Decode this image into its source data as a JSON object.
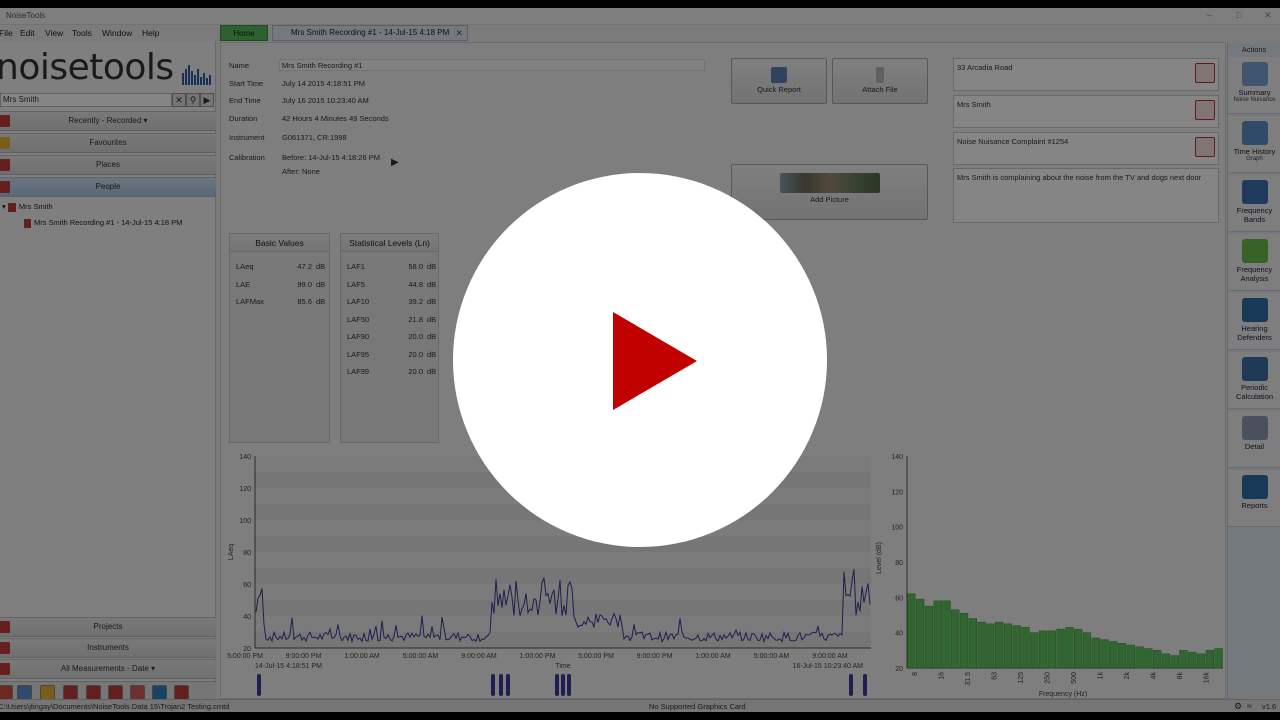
{
  "window": {
    "title": "NoiseTools"
  },
  "menu": [
    "File",
    "Edit",
    "View",
    "Tools",
    "Window",
    "Help"
  ],
  "logo": {
    "text": "noisetools"
  },
  "search": {
    "value": "Mrs Smith"
  },
  "nav": {
    "recent": "Recently - Recorded",
    "favourites": "Favourites",
    "places": "Places",
    "people": "People",
    "projects": "Projects",
    "instruments": "Instruments",
    "all_measurements": "All Measurements - Date"
  },
  "tree": {
    "person": "Mrs Smith",
    "recording": "Mrs Smith Recording #1 - 14-Jul-15 4:18 PM"
  },
  "tabs": {
    "home": "Home",
    "recording": "Mrs Smith Recording #1 - 14-Jul-15 4:18 PM"
  },
  "info": {
    "name_label": "Name",
    "name": "Mrs Smith Recording #1",
    "start_label": "Start Time",
    "start": "July 14 2015 4:18:51 PM",
    "end_label": "End Time",
    "end": "July 16 2015 10:23:40 AM",
    "duration_label": "Duration",
    "duration": "42 Hours 4 Minutes 49 Seconds",
    "instrument_label": "Instrument",
    "instrument": "G061371, CR:1998",
    "calibration_label": "Calibration",
    "cal_before": "Before: 14-Jul-15 4:18:26 PM",
    "cal_after": "After: None"
  },
  "buttons": {
    "quick_report": "Quick Report",
    "attach_file": "Attach File",
    "add_picture": "Add Picture"
  },
  "right_info": {
    "address": "33 Arcadia Road",
    "person": "Mrs Smith",
    "complaint": "Noise Nuisance Complaint #1254",
    "notes": "Mrs Smith is complaining about the noise from the TV and dogs next door"
  },
  "basic_values": {
    "title": "Basic Values",
    "unit": "dB",
    "rows": [
      {
        "name": "LAeq",
        "value": "47.2"
      },
      {
        "name": "LAE",
        "value": "99.0"
      },
      {
        "name": "LAFMax",
        "value": "85.6"
      }
    ]
  },
  "stat_levels": {
    "title": "Statistical Levels (Ln)",
    "unit": "dB",
    "rows": [
      {
        "name": "LAF1",
        "value": "58.0"
      },
      {
        "name": "LAF5",
        "value": "44.8"
      },
      {
        "name": "LAF10",
        "value": "39.2"
      },
      {
        "name": "LAF50",
        "value": "21.8"
      },
      {
        "name": "LAF90",
        "value": "20.0"
      },
      {
        "name": "LAF95",
        "value": "20.0"
      },
      {
        "name": "LAF99",
        "value": "20.0"
      }
    ]
  },
  "time_chart": {
    "ylabel": "LAeq",
    "xlabel": "Time",
    "ylim": [
      20,
      140
    ],
    "yticks": [
      "140",
      "120",
      "100",
      "80",
      "60",
      "40",
      "20"
    ],
    "xticks": [
      "5:00:00 PM",
      "9:00:00 PM",
      "1:00:00 AM",
      "5:00:00 AM",
      "9:00:00 AM",
      "1:00:00 PM",
      "5:00:00 PM",
      "9:00:00 PM",
      "1:00:00 AM",
      "5:00:00 AM",
      "9:00:00 AM"
    ],
    "start_label": "14-Jul-15 4:18:51 PM",
    "end_label": "16-Jul-15 10:23:40 AM",
    "color": "#3a3a9a"
  },
  "freq_chart": {
    "ylabel": "Level (dB)",
    "xlabel": "Frequency (Hz)",
    "ylim": [
      20,
      140
    ],
    "yticks": [
      "140",
      "120",
      "100",
      "80",
      "60",
      "40",
      "20"
    ],
    "xticks": [
      "8",
      "16",
      "31.5",
      "63",
      "125",
      "250",
      "500",
      "1k",
      "2k",
      "4k",
      "8k",
      "16k"
    ],
    "color": "#5ec45e",
    "values": [
      62,
      59,
      55,
      58,
      58,
      53,
      51,
      48,
      46,
      45,
      46,
      45,
      44,
      43,
      40,
      41,
      41,
      42,
      43,
      42,
      40,
      37,
      36,
      35,
      34,
      33,
      32,
      31,
      30,
      28,
      27,
      30,
      29,
      28,
      30,
      31
    ]
  },
  "actions": {
    "header": "Actions",
    "items": [
      {
        "label": "Summary",
        "sub": "Noise Nuisance"
      },
      {
        "label": "Time History",
        "sub": "Graph"
      },
      {
        "label": "Frequency Bands",
        "sub": ""
      },
      {
        "label": "Frequency Analysis",
        "sub": ""
      },
      {
        "label": "Hearing Defenders",
        "sub": ""
      },
      {
        "label": "Periodic Calculation",
        "sub": ""
      },
      {
        "label": "Detail",
        "sub": ""
      },
      {
        "label": "Reports",
        "sub": ""
      }
    ]
  },
  "status": {
    "path": "C:\\Users\\jtingay\\Documents\\NoiseTools Data 15\\Trojan2 Testing.cmtd",
    "message": "No Supported Graphics Card",
    "version": "v1.6"
  }
}
